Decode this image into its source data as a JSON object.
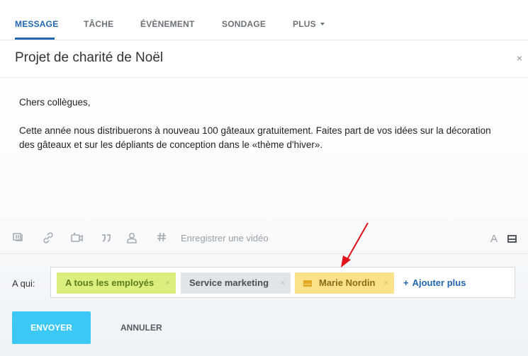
{
  "tabs": [
    {
      "label": "MESSAGE",
      "active": true
    },
    {
      "label": "TÂCHE",
      "active": false
    },
    {
      "label": "ÉVÈNEMENT",
      "active": false
    },
    {
      "label": "SONDAGE",
      "active": false
    },
    {
      "label": "PLUS",
      "active": false
    }
  ],
  "header": {
    "title": "Projet de charité de Noël",
    "close_glyph": "×"
  },
  "message": {
    "greeting": "Chers collègues,",
    "paragraph": "Cette année nous distribuerons à nouveau 100 gâteaux gratuitement. Faites part de vos idées sur la décoration des gâteaux et sur les dépliants de conception dans le «thème d'hiver»."
  },
  "toolbar": {
    "icons": [
      "attach-icon",
      "link-icon",
      "video-icon",
      "quote-icon",
      "mention-icon",
      "hashtag-icon"
    ],
    "record_video": "Enregistrer une vidéo",
    "font_glyph": "A"
  },
  "recipients": {
    "label": "A qui:",
    "chips": [
      {
        "label": "A tous les employés",
        "color": "#dbef7f"
      },
      {
        "label": "Service marketing",
        "color": "#e2e5e8"
      },
      {
        "label": "Marie Nordin",
        "color": "#fbe28a",
        "icon": "envelope-icon"
      }
    ],
    "remove_glyph": "×",
    "add_more": "Ajouter plus"
  },
  "actions": {
    "send": "ENVOYER",
    "cancel": "ANNULER"
  },
  "colors": {
    "accent": "#2067b0",
    "send_button": "#3bc8f5",
    "annotation_arrow": "#e0121b"
  }
}
